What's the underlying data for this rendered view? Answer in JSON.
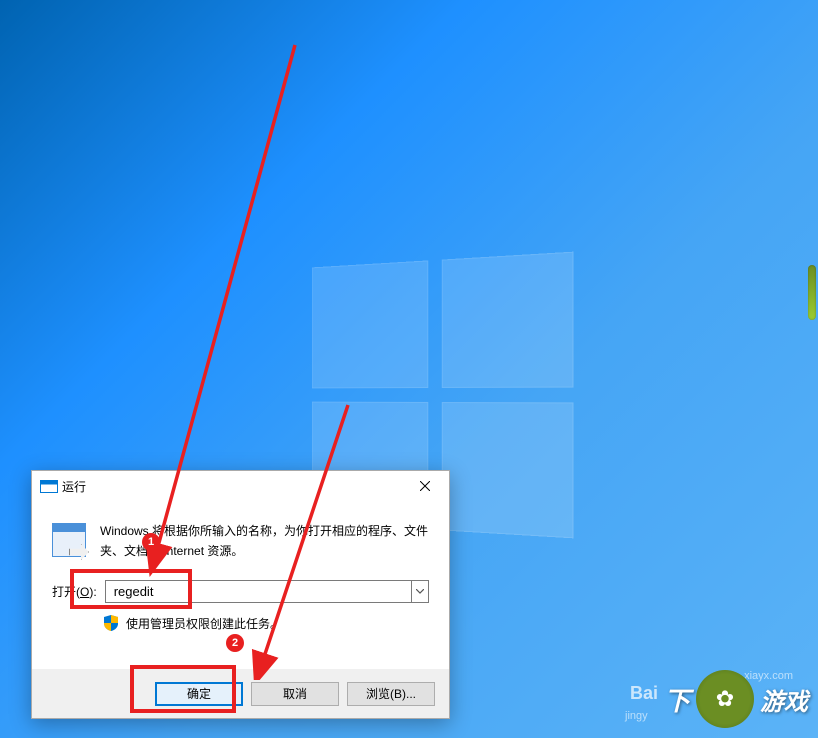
{
  "dialog": {
    "title": "运行",
    "description": "Windows 将根据你所输入的名称，为你打开相应的程序、文件夹、文档或 Internet 资源。",
    "input_label_prefix": "打开(",
    "input_label_underline": "O",
    "input_label_suffix": "):",
    "input_value": "regedit",
    "shield_text": "使用管理员权限创建此任务。",
    "buttons": {
      "ok": "确定",
      "cancel": "取消",
      "browse": "浏览(B)..."
    }
  },
  "annotations": {
    "badge_1": "1",
    "badge_2": "2"
  },
  "watermarks": {
    "xiayx": "xiayx.com",
    "baidu": "Bai",
    "jingy": "jingy",
    "game_text": "游戏",
    "site_name": "下"
  }
}
